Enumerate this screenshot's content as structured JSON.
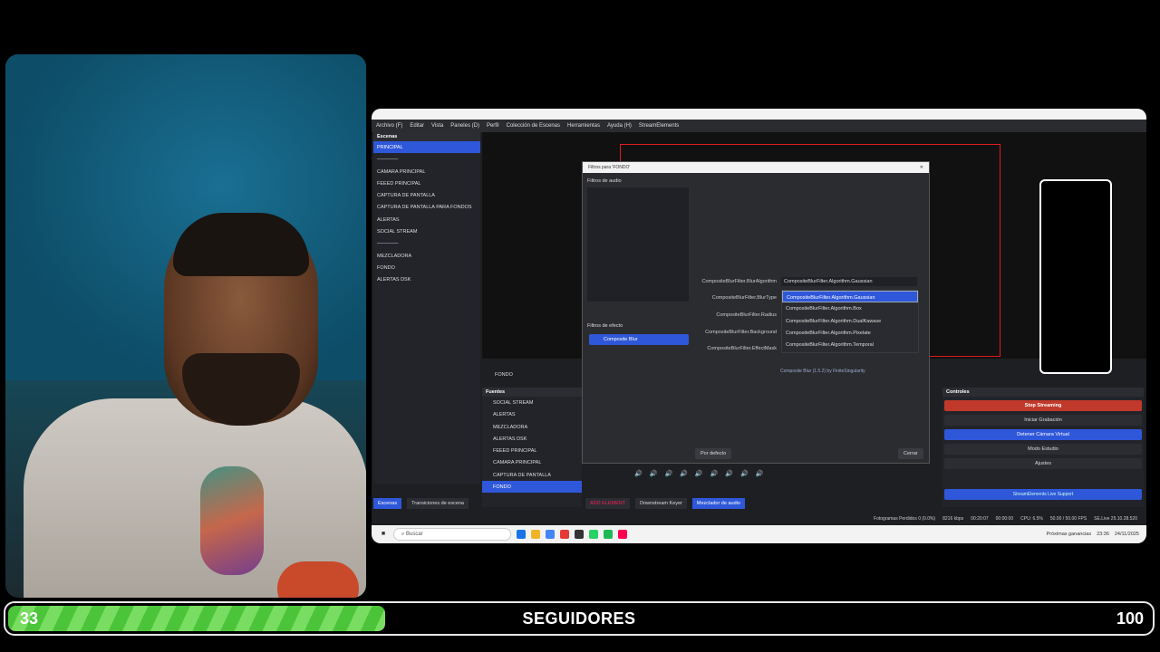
{
  "obs": {
    "menu": [
      "Archivo (F)",
      "Editar",
      "Vista",
      "Paneles (D)",
      "Perfil",
      "Colección de Escenas",
      "Herramientas",
      "Ayuda (H)",
      "StreamElements"
    ],
    "scenes_header": "Escenas",
    "scenes": [
      "PRINCIPAL",
      "──────",
      "CAMARA PRINCIPAL",
      "FEEED PRINCIPAL",
      "CAPTURA DE PANTALLA",
      "CAPTURA DE PANTALLA PARA FONDOS",
      "ALERTAS",
      "SOCIAL STREAM",
      "──────",
      "MEZCLADORA",
      "FONDO",
      "ALERTAS DSK"
    ],
    "dialog": {
      "title": "Filtros para 'FONDO'",
      "audio_filters_label": "Filtros de audio",
      "effect_filters_label": "Filtros de efecto",
      "selected_filter": "Composite Blur",
      "prop_labels": [
        "CompositeBlurFilter.BlurAlgorithm",
        "CompositeBlurFilter.BlurType",
        "CompositeBlurFilter.Radius",
        "CompositeBlurFilter.Background",
        "CompositeBlurFilter.EffectMask"
      ],
      "combo_value": "CompositeBlurFilter.Algorithm.Gaussian",
      "dropdown_options": [
        "CompositeBlurFilter.Algorithm.Gaussian",
        "CompositeBlurFilter.Algorithm.Box",
        "CompositeBlurFilter.Algorithm.DualKawase",
        "CompositeBlurFilter.Algorithm.Pixelate",
        "CompositeBlurFilter.Algorithm.Temporal"
      ],
      "credit": "Composite Blur (1.5.2) by FiniteSingularity",
      "defaults_button": "Por defecto",
      "close_button": "Cerrar"
    },
    "fondo_label": "FONDO",
    "sources_header": "Fuentes",
    "sources": [
      "SOCIAL STREAM",
      "ALERTAS",
      "MEZCLADORA",
      "ALERTAS DSK",
      "FEEED PRINCIPAL",
      "CAMARA PRINCIPAL",
      "CAPTURA DE PANTALLA",
      "FONDO"
    ],
    "controls_header": "Controles",
    "controls": [
      "Stop Streaming",
      "Iniciar Grabación",
      "Detener Cámara Virtual",
      "Modo Estudio",
      "Ajustes"
    ],
    "se_button": "StreamElements Live Support",
    "tabs_left": [
      "Escenas",
      "Transiciones de escena"
    ],
    "tabs_mid": [
      "ADD ELEMENT",
      "Downstream Keyer",
      "Mezclador de audio"
    ],
    "status": {
      "frames": "Fotogramas Perdidos 0 (0.0%)",
      "bitrate": "8216 kbps",
      "time1": "00:20:07",
      "time2": "00:00:00",
      "cpu": "CPU: 6.5%",
      "fps": "50.00 / 50.00 FPS",
      "se": "SE.Live 25.10.28.520"
    },
    "taskbar": {
      "search_placeholder": "Buscar",
      "tray_text": "Próximas ganancias",
      "clock_time": "23:36",
      "clock_date": "24/11/2025"
    }
  },
  "goal": {
    "current": "33",
    "title": "SEGUIDORES",
    "max": "100",
    "progress": 0.33,
    "fill_color": "#4cc43a"
  }
}
